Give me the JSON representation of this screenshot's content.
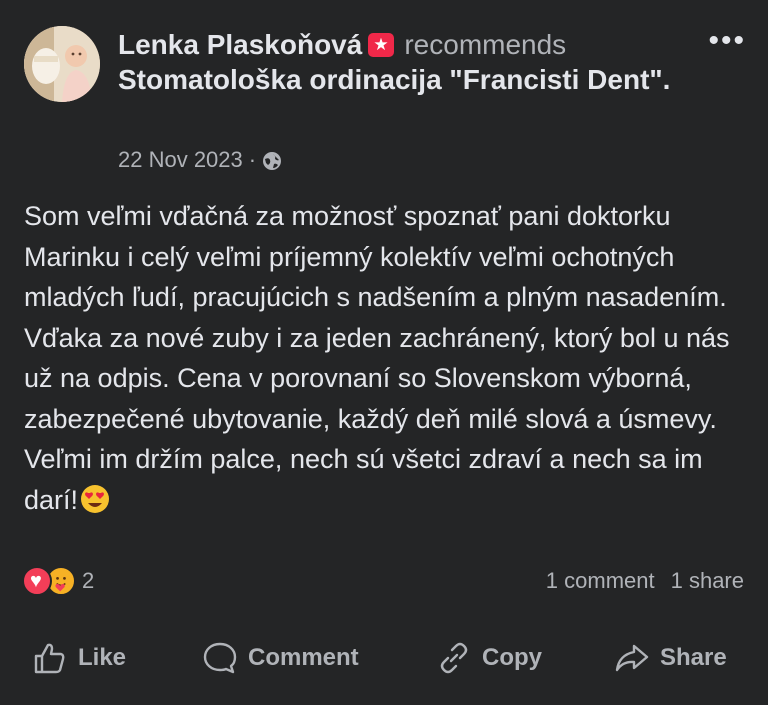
{
  "post": {
    "author": "Lenka Plaskoňová",
    "action": "recommends",
    "page_name": "Stomatološka ordinacija \"Francisti Dent\".",
    "date": "22 Nov 2023",
    "separator": "·",
    "visibility_icon": "globe-icon",
    "more_label": "•••",
    "body": "Som veľmi vďačná za možnosť spoznať pani doktorku Marinku i celý veľmi príjemný kolektív veľmi ochotných mladých ľudí, pracujúcich s nadšením a plným nasadením. Vďaka za nové zuby i za jeden zachránený, ktorý bol u nás už na odpis. Cena v porovnaní so Slovenskom výborná, zabezpečené ubytovanie, každý deň milé slová a úsmevy. Veľmi im držím palce, nech sú všetci zdraví a nech sa im darí!"
  },
  "reactions": {
    "icons": [
      "love-reaction-icon",
      "care-reaction-icon"
    ],
    "count": "2"
  },
  "stats": {
    "comments": "1 comment",
    "shares": "1 share"
  },
  "actions": {
    "like": "Like",
    "comment": "Comment",
    "copy": "Copy",
    "share": "Share"
  },
  "colors": {
    "background": "#242526",
    "text_primary": "#e4e6eb",
    "text_secondary": "#b0b3b8",
    "badge": "#f02849"
  }
}
